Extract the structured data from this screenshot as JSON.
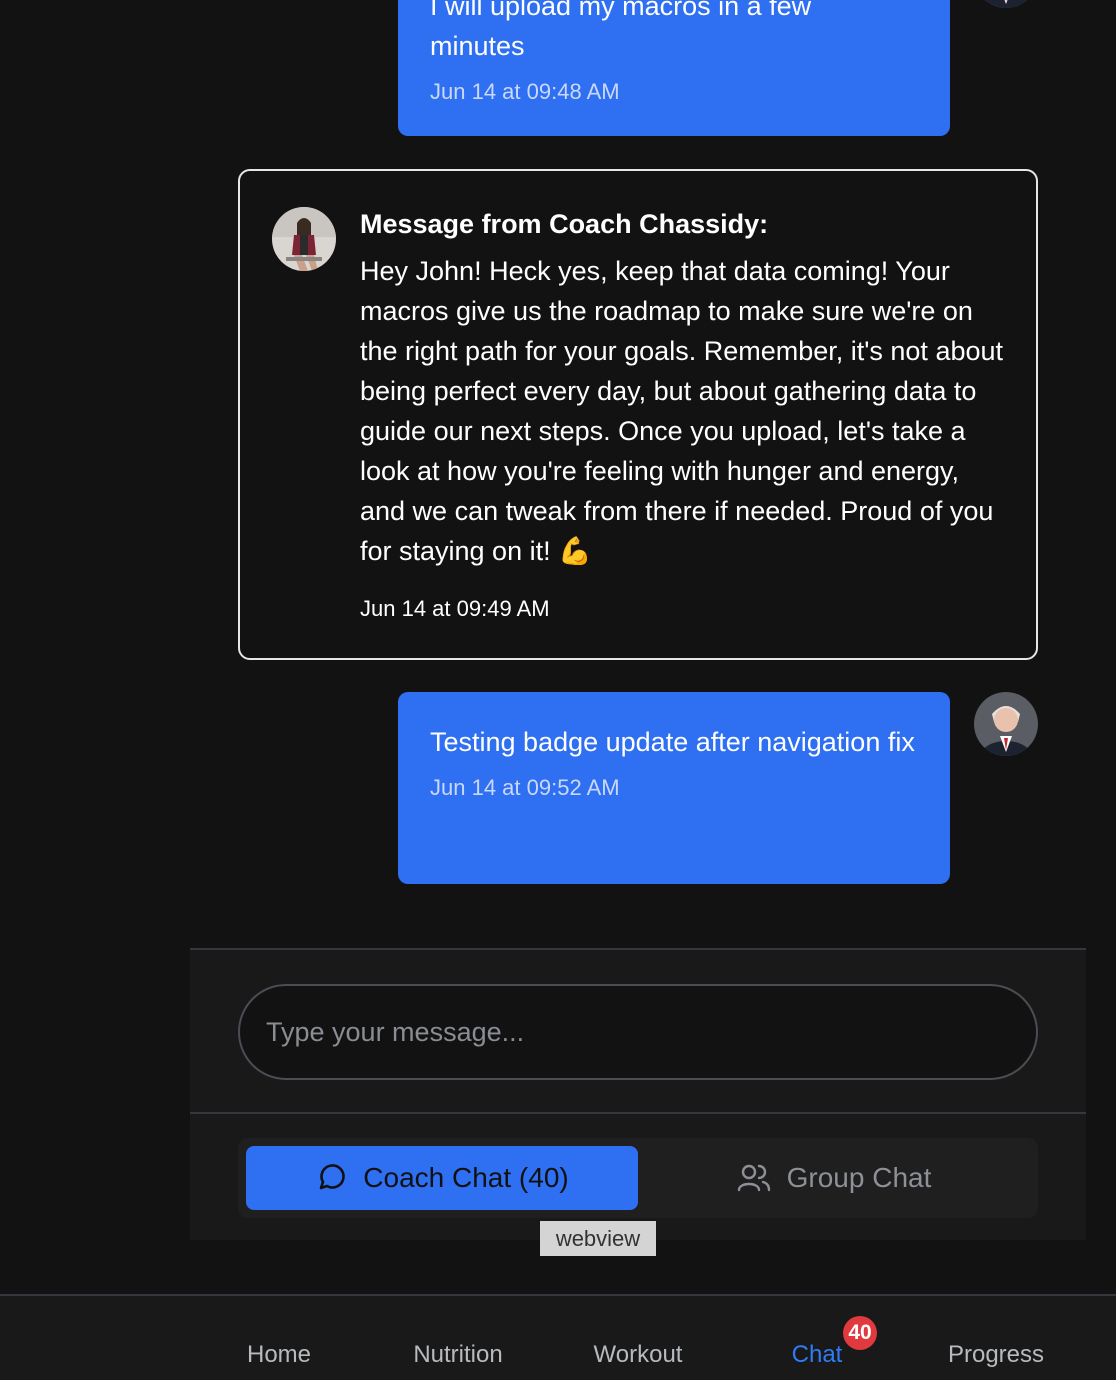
{
  "messages": [
    {
      "sender": "user",
      "text": "I will upload my macros in a few minutes",
      "text_line_2": "minutes",
      "timestamp": "Jun 14 at 09:48 AM"
    },
    {
      "sender": "coach",
      "title": "Message from Coach Chassidy:",
      "text": "Hey John! Heck yes, keep that data coming! Your macros give us the roadmap to make sure we're on the right path for your goals. Remember, it's not about being perfect every day, but about gathering data to guide our next steps. Once you upload, let's take a look at how you're feeling with hunger and energy, and we can tweak from there if needed. Proud of you for staying on it! 💪",
      "timestamp": "Jun 14 at 09:49 AM"
    },
    {
      "sender": "user",
      "text": "Testing badge update after navigation fix",
      "timestamp": "Jun 14 at 09:52 AM"
    }
  ],
  "composer": {
    "placeholder": "Type your message...",
    "value": ""
  },
  "chat_tabs": {
    "coach": {
      "label": "Coach Chat (40)",
      "icon": "chat-bubble-icon",
      "active": true
    },
    "group": {
      "label": "Group Chat",
      "icon": "users-icon",
      "active": false
    }
  },
  "webview_label": "webview",
  "bottom_nav": {
    "items": [
      {
        "label": "Home"
      },
      {
        "label": "Nutrition"
      },
      {
        "label": "Workout"
      },
      {
        "label": "Chat",
        "active": true
      },
      {
        "label": "Progress"
      }
    ],
    "chat_badge": "40"
  },
  "colors": {
    "background": "#121212",
    "accent": "#2f6ff2",
    "badge": "#e0393e"
  }
}
